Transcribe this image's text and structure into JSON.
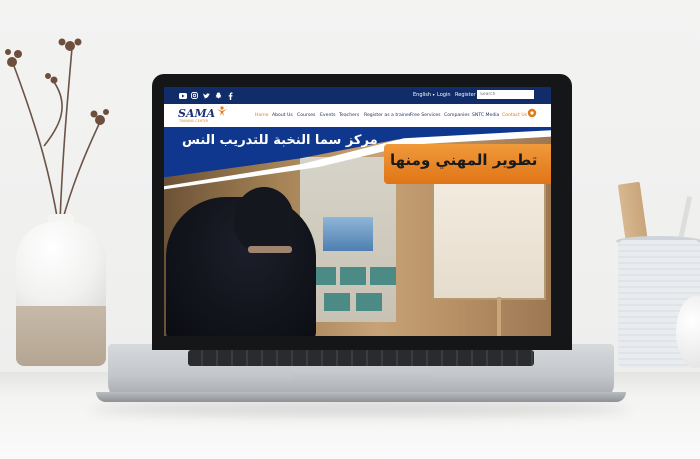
{
  "topbar": {
    "social_icons": [
      "youtube-icon",
      "instagram-icon",
      "twitter-icon",
      "snapchat-icon",
      "facebook-icon"
    ],
    "language": "English",
    "login": "Login",
    "register": "Register",
    "search_placeholder": "Search"
  },
  "navbar": {
    "logo_text": "SAMA",
    "logo_subtext": "TRAINING CENTER",
    "items": [
      {
        "label": "Home",
        "active": true
      },
      {
        "label": "About Us"
      },
      {
        "label": "Courses"
      },
      {
        "label": "Events"
      },
      {
        "label": "Teachers"
      },
      {
        "label": "Register as a trainer"
      },
      {
        "label": "Free Services"
      },
      {
        "label": "Companies"
      },
      {
        "label": "SNTC Media"
      },
      {
        "label": "Contact Us"
      }
    ]
  },
  "hero": {
    "headline_primary": "مركز سما النخبة للتدريب النس",
    "headline_secondary": "تطوير المهني ومنها"
  },
  "colors": {
    "topbar_bg": "#102d69",
    "accent_orange": "#e07b1a",
    "hero_blue": "#10378e"
  }
}
